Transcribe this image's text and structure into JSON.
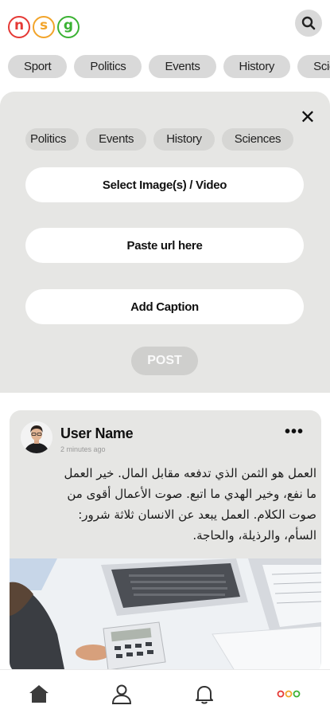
{
  "header": {
    "logo_letters": [
      {
        "letter": "n",
        "color": "#e53935"
      },
      {
        "letter": "s",
        "color": "#f2a42a"
      },
      {
        "letter": "g",
        "color": "#3bb233"
      }
    ],
    "search_icon": "search-icon"
  },
  "categories": [
    "Sport",
    "Politics",
    "Events",
    "History",
    "Sciences"
  ],
  "compose": {
    "close_icon": "close-icon",
    "categories": [
      "Politics",
      "Events",
      "History",
      "Sciences"
    ],
    "select_media_label": "Select Image(s) / Video",
    "paste_url_label": "Paste url here",
    "add_caption_label": "Add Caption",
    "post_label": "POST"
  },
  "post": {
    "user_name": "User Name",
    "timestamp": "2 minutes ago",
    "more_icon": "more-horizontal-icon",
    "body_lines": [
      "العمل هو الثمن الذي تدفعه مقابل المال. خير العمل",
      "ما نفع، وخير الهدي ما اتبع. صوت الأعمال أقوى من",
      "صوت الكلام. العمل يبعد عن الانسان ثلاثة شرور:",
      "السأم، والرذيلة، والحاجة."
    ]
  },
  "bottom_nav": [
    {
      "name": "home",
      "icon": "home-icon"
    },
    {
      "name": "profile",
      "icon": "user-icon"
    },
    {
      "name": "notifications",
      "icon": "bell-icon"
    },
    {
      "name": "menu",
      "icon": "nsg-dots-icon"
    }
  ],
  "colors": {
    "chip_bg": "#d9d9d9",
    "panel_bg": "#e6e6e4",
    "logo_red": "#e53935",
    "logo_orange": "#f2a42a",
    "logo_green": "#3bb233"
  }
}
